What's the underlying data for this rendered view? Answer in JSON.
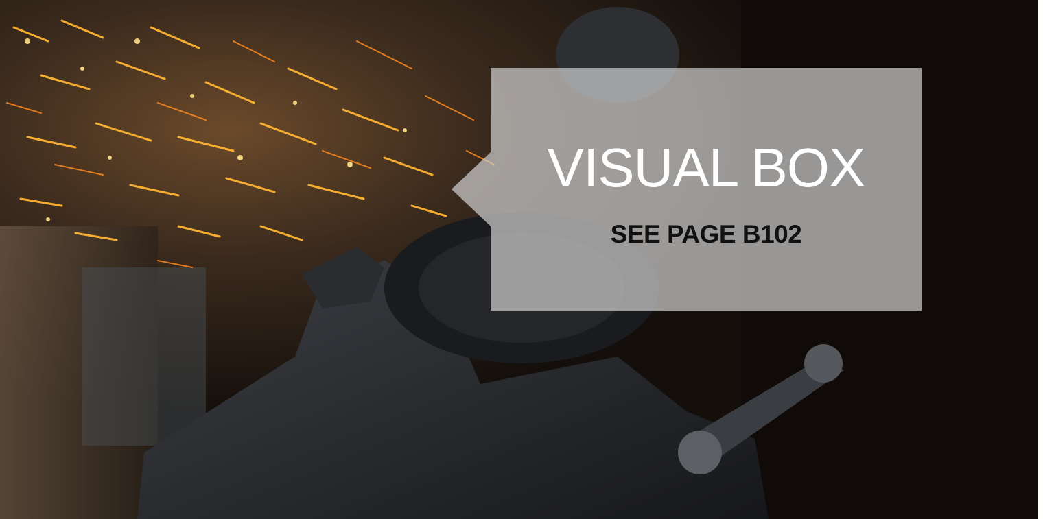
{
  "visual_box": {
    "title": "VISUAL BOX",
    "subtitle": "SEE PAGE B102"
  },
  "background_image": {
    "subject": "angle-grinder-sparks-photo",
    "colors": {
      "dark": "#140f0b",
      "spark": "#ffb533",
      "overlay": "#cdcdcd"
    }
  }
}
